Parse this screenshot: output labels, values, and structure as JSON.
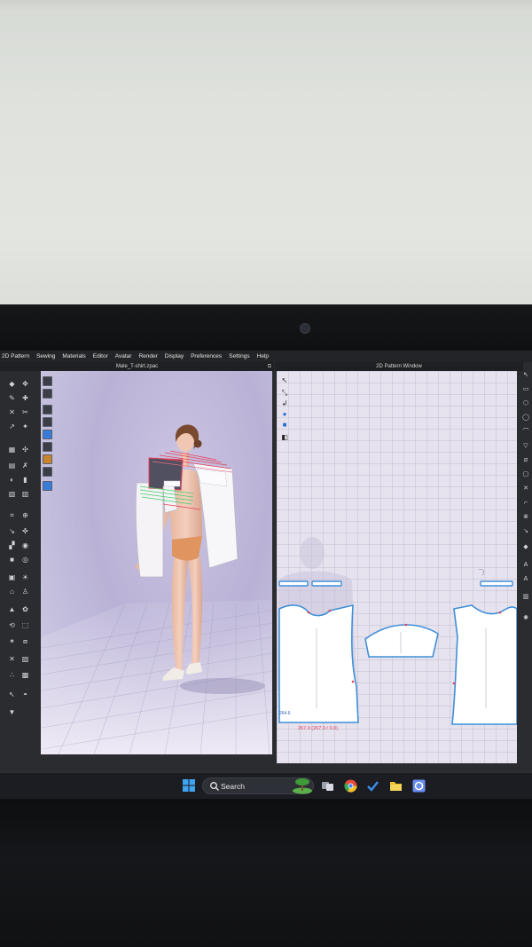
{
  "menu": [
    "2D Pattern",
    "Sewing",
    "Materials",
    "Editor",
    "Avatar",
    "Render",
    "Display",
    "Preferences",
    "Settings",
    "Help"
  ],
  "window_3d": {
    "title": "Male_T-shirt.zpac",
    "restore_glyph": "⧉"
  },
  "window_2d": {
    "title": "2D Pattern Window"
  },
  "readouts": {
    "pattern_small": "264.6",
    "pattern_red": "267.9 (267.9 / 0.0)"
  },
  "taskbar": {
    "search_label": "Search"
  },
  "colors": {
    "pattern_outline": "#3f8fd8",
    "highlight_red": "#e8405a",
    "highlight_green": "#3fd06a",
    "viewport_bg": "#bdb6d8",
    "canvas_bg": "#e6e2ee"
  },
  "icons": {
    "start": "windows-start-icon",
    "search": "search-icon",
    "weather": "weather-icon",
    "apps": [
      "task-view-icon",
      "chrome-icon",
      "todo-icon",
      "file-explorer-icon",
      "clo3d-icon"
    ]
  }
}
